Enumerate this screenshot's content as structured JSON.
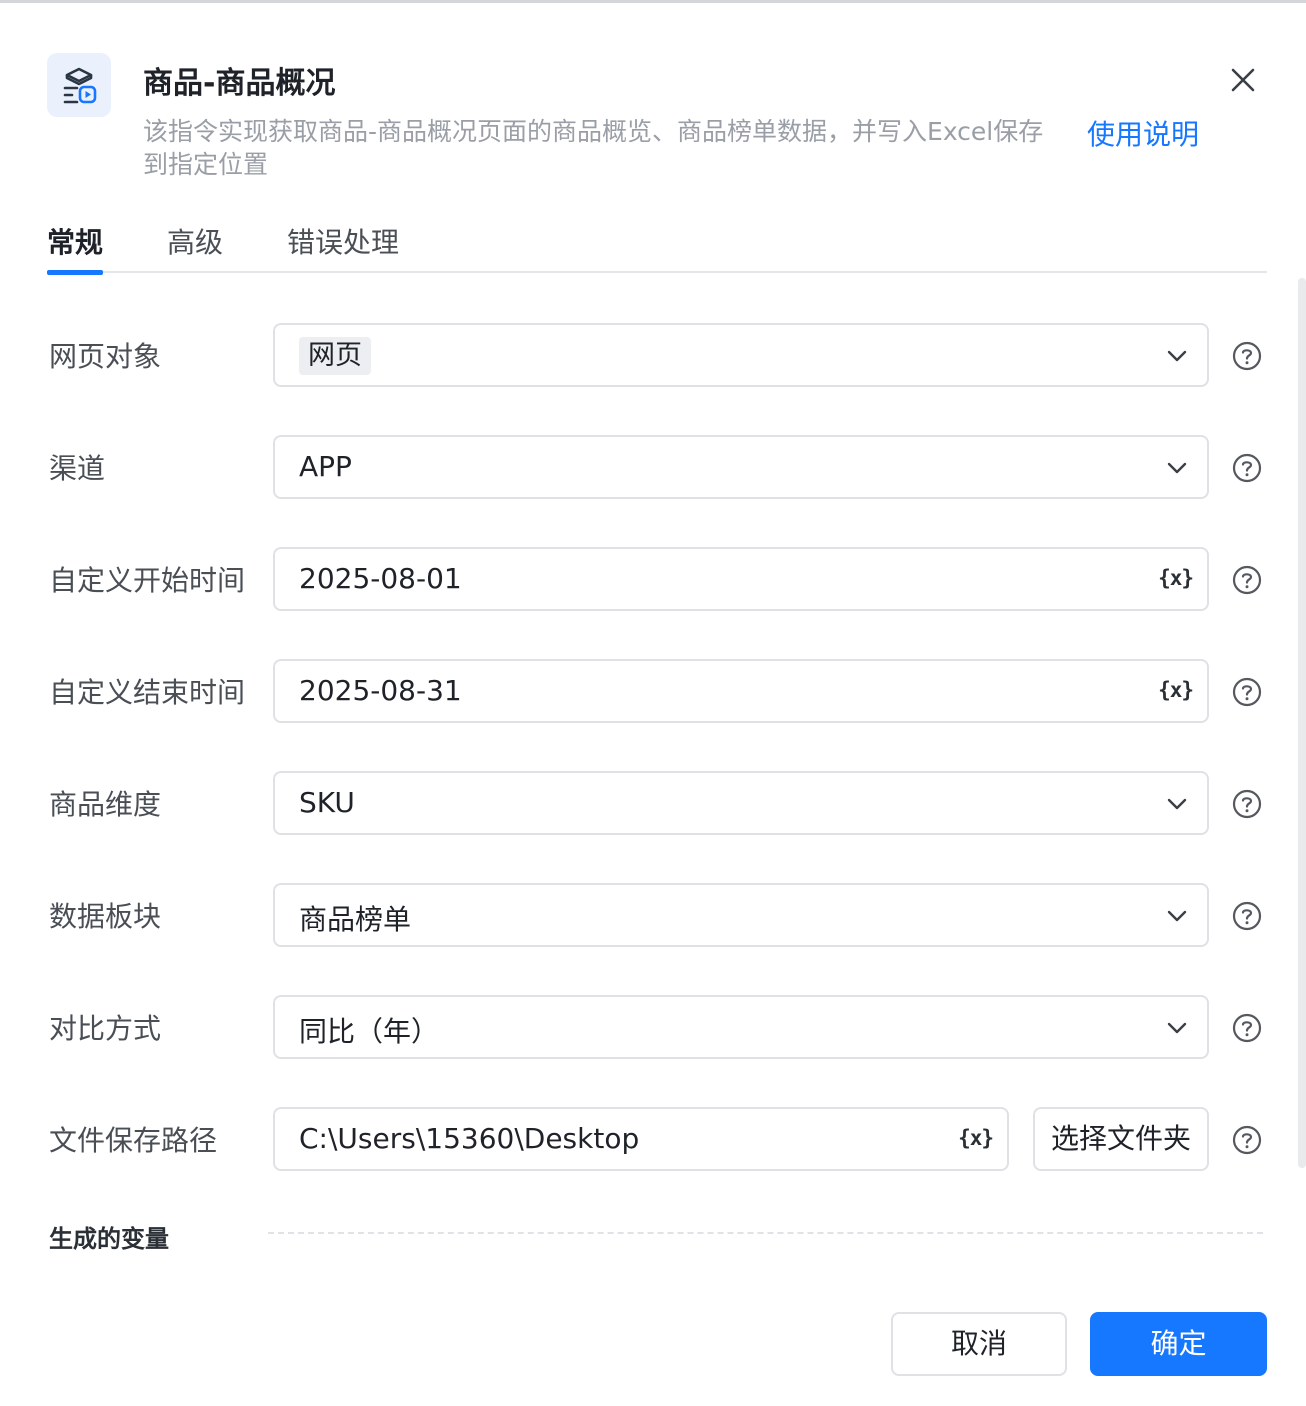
{
  "header": {
    "title": "商品-商品概况",
    "description": "该指令实现获取商品-商品概况页面的商品概览、商品榜单数据，并写入Excel保存到指定位置",
    "help_link": "使用说明",
    "icon": "command-module-icon"
  },
  "tabs": [
    {
      "label": "常规",
      "active": true
    },
    {
      "label": "高级",
      "active": false
    },
    {
      "label": "错误处理",
      "active": false
    }
  ],
  "fields": {
    "web_object": {
      "label": "网页对象",
      "value": "网页"
    },
    "channel": {
      "label": "渠道",
      "value": "APP"
    },
    "start_time": {
      "label": "自定义开始时间",
      "value": "2025-08-01"
    },
    "end_time": {
      "label": "自定义结束时间",
      "value": "2025-08-31"
    },
    "product_dimension": {
      "label": "商品维度",
      "value": "SKU"
    },
    "data_block": {
      "label": "数据板块",
      "value": "商品榜单"
    },
    "compare_mode": {
      "label": "对比方式",
      "value": "同比（年）"
    },
    "save_path": {
      "label": "文件保存路径",
      "value": "C:\\Users\\15360\\Desktop",
      "button": "选择文件夹"
    }
  },
  "variable_icon_text": "{x}",
  "generated_vars": {
    "title": "生成的变量"
  },
  "footer": {
    "cancel": "取消",
    "ok": "确定"
  },
  "colors": {
    "accent": "#1677ff",
    "icon_bg": "#eaf1fd"
  }
}
